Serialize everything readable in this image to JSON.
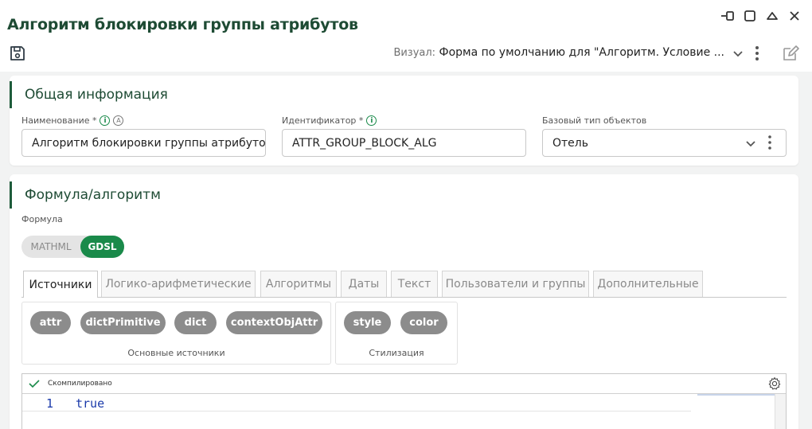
{
  "header": {
    "title": "Алгоритм блокировки группы атрибутов",
    "visual_label": "Визуал:",
    "visual_value": "Форма по умолчанию для \"Алгоритм. Условие ..."
  },
  "general": {
    "title": "Общая информация",
    "name_label": "Наименование *",
    "name_value": "Алгоритм блокировки группы атрибутов",
    "id_label": "Идентификатор *",
    "id_value": "ATTR_GROUP_BLOCK_ALG",
    "type_label": "Базовый тип объектов",
    "type_value": "Отель",
    "info_glyph": "i",
    "auto_glyph": "A"
  },
  "formula": {
    "title": "Формула/алгоритм",
    "formula_label": "Формула",
    "toggle": {
      "options": [
        "MATHML",
        "GDSL"
      ],
      "selected": "GDSL"
    },
    "tabs": [
      {
        "label": "Источники",
        "active": true
      },
      {
        "label": "Логико-арифметические",
        "active": false
      },
      {
        "label": "Алгоритмы",
        "active": false
      },
      {
        "label": "Даты",
        "active": false
      },
      {
        "label": "Текст",
        "active": false
      },
      {
        "label": "Пользователи и группы",
        "active": false
      },
      {
        "label": "Дополнительные",
        "active": false
      }
    ],
    "groups": [
      {
        "caption": "Основные источники",
        "chips": [
          "attr",
          "dictPrimitive",
          "dict",
          "contextObjAttr"
        ]
      },
      {
        "caption": "Стилизация",
        "chips": [
          "style",
          "color"
        ]
      }
    ],
    "editor": {
      "status": "Скомпилировано",
      "lines": [
        {
          "number": "1",
          "code": "true"
        }
      ]
    }
  },
  "colors": {
    "accent": "#1a8a4a",
    "title": "#1e4b34",
    "chip": "#8c8c8c",
    "code": "#1a3aaa"
  },
  "icons": [
    "minimize-icon",
    "maximize-icon",
    "collapse-icon",
    "close-icon",
    "save-icon",
    "chevron-down-icon",
    "kebab-icon",
    "edit-icon",
    "info-icon",
    "check-icon",
    "gear-icon"
  ]
}
